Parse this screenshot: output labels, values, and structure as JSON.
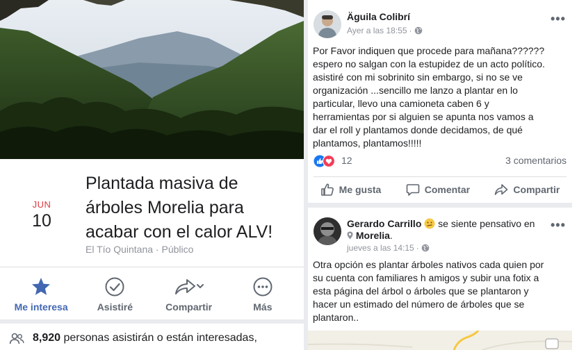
{
  "event": {
    "month": "JUN",
    "day": "10",
    "title": "Plantada masiva de árboles Morelia para acabar con el calor ALV!",
    "host": "El Tío Quintana",
    "separator": "·",
    "privacy": "Público",
    "actions": [
      {
        "label": "Me interesa",
        "icon": "star-icon",
        "active": true
      },
      {
        "label": "Asistiré",
        "icon": "check-circle-icon",
        "active": false
      },
      {
        "label": "Compartir",
        "icon": "share-icon",
        "active": false
      },
      {
        "label": "Más",
        "icon": "more-circle-icon",
        "active": false
      }
    ],
    "attendance_count": "8,920",
    "attendance_text": "personas asistirán o están interesadas,"
  },
  "posts": [
    {
      "author": "Äguila Colibrí",
      "time": "Ayer a las 18:55",
      "separator": "·",
      "text_lines": [
        "Por Favor indiquen que procede para mañana??????",
        "espero no salgan con la estupidez de un acto político.",
        "asistiré con mi sobrinito sin embargo, si no se ve",
        "organización ...sencillo me lanzo a plantar en lo",
        "particular, llevo una camioneta caben 6 y",
        "herramientas por si alguien se apunta nos vamos a",
        "dar el roll y plantamos donde decidamos, de qué",
        "plantamos, plantamos!!!!!"
      ],
      "reactions_count": "12",
      "comments": "3 comentarios",
      "actions": {
        "like": "Me gusta",
        "comment": "Comentar",
        "share": "Compartir"
      }
    },
    {
      "author": "Gerardo Carrillo",
      "feeling": "se siente pensativo en",
      "location": "Morelia",
      "location_suffix": ".",
      "time": "jueves a las 14:15",
      "separator": "·",
      "text_lines": [
        "Otra opción es plantar árboles nativos cada quien por",
        "su cuenta con familiares h amigos y subir una fotix a",
        "esta página del árbol o árboles que se plantaron y",
        "hacer un estimado del número de árboles que se",
        "plantaron.."
      ]
    }
  ],
  "colors": {
    "accent": "#4267b2",
    "date_red": "#e0393e",
    "muted": "#90949c",
    "divider": "#e9ebee"
  }
}
